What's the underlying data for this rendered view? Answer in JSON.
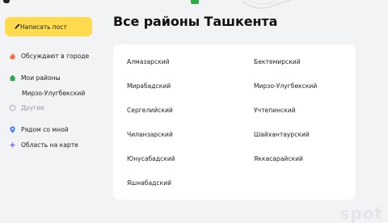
{
  "sidebar": {
    "write_post_label": "Написать пост",
    "items": [
      {
        "label": "Обсуждают в городе",
        "icon": "fire-icon"
      },
      {
        "label": "Мои районы",
        "icon": "home-icon"
      },
      {
        "label": "Мирзо-Улугбекский"
      },
      {
        "label": "Другие",
        "icon": "plus-circle-icon"
      },
      {
        "label": "Рядом со мной",
        "icon": "location-pin-icon"
      },
      {
        "label": "Область на карте",
        "icon": "map-star-icon"
      }
    ]
  },
  "main": {
    "title": "Все районы Ташкента",
    "districts_left": [
      "Алмазарский",
      "Мирабадский",
      "Сергелийский",
      "Чиланзарский",
      "Юнусабадский",
      "Яшнабадский"
    ],
    "districts_right": [
      "Бектемирский",
      "Мирзо-Улугбекский",
      "Учтепинский",
      "Шайхантаурский",
      "Яккасарайский"
    ]
  },
  "watermark": "spot",
  "colors": {
    "accent": "#ffdb4d",
    "background": "#f2f3f5",
    "card": "#ffffff",
    "fire": "#ff6a3d",
    "home": "#2ea84a",
    "muted": "#9a9aa6",
    "pin": "#3d7bff",
    "star": "#8b5cf6"
  }
}
